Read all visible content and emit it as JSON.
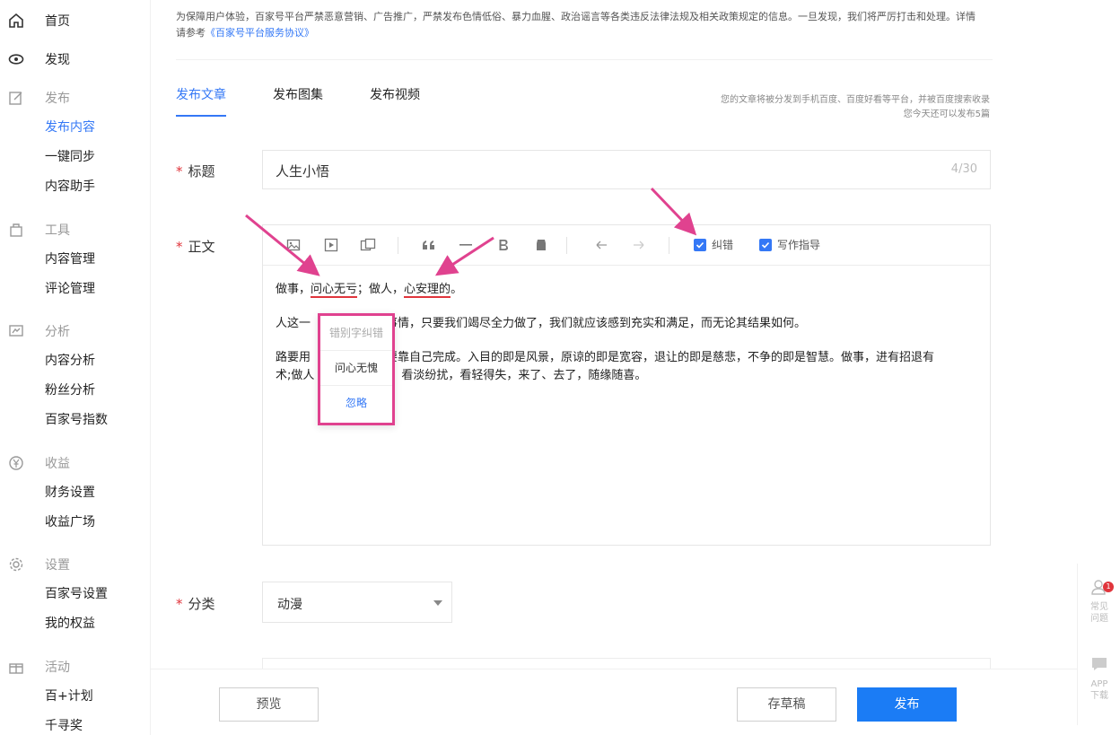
{
  "sidebar": {
    "groups": [
      {
        "icon": "home-icon",
        "label": "首页",
        "items": []
      },
      {
        "icon": "eye-icon",
        "label": "发现",
        "items": []
      },
      {
        "icon": "edit-icon",
        "label": "发布",
        "items": [
          "发布内容",
          "一键同步",
          "内容助手"
        ],
        "active_item": "发布内容"
      },
      {
        "icon": "briefcase-icon",
        "label": "工具",
        "items": [
          "内容管理",
          "评论管理"
        ]
      },
      {
        "icon": "chart-icon",
        "label": "分析",
        "items": [
          "内容分析",
          "粉丝分析",
          "百家号指数"
        ]
      },
      {
        "icon": "yuan-icon",
        "label": "收益",
        "items": [
          "财务设置",
          "收益广场"
        ]
      },
      {
        "icon": "gear-icon",
        "label": "设置",
        "items": [
          "百家号设置",
          "我的权益"
        ]
      },
      {
        "icon": "gift-icon",
        "label": "活动",
        "items": [
          "百+计划",
          "千寻奖"
        ]
      }
    ]
  },
  "notice": {
    "text": "为保障用户体验，百家号平台严禁恶意营销、广告推广，严禁发布色情低俗、暴力血腥、政治谣言等各类违反法律法规及相关政策规定的信息。一旦发现，我们将严厉打击和处理。详情请参考",
    "link": "《百家号平台服务协议》"
  },
  "tabs": [
    {
      "label": "发布文章",
      "active": true
    },
    {
      "label": "发布图集",
      "active": false
    },
    {
      "label": "发布视频",
      "active": false
    }
  ],
  "info": {
    "line1": "您的文章将被分发到手机百度、百度好看等平台，并被百度搜索收录",
    "line2": "您今天还可以发布5篇"
  },
  "form": {
    "title_label": "标题",
    "title_value": "人生小悟",
    "title_count": "4/30",
    "body_label": "正文",
    "category_label": "分类",
    "category_value": "动漫",
    "required_mark": "*"
  },
  "toolbar": {
    "icons": [
      "image-icon",
      "video-icon",
      "gallery-icon",
      "quote-icon",
      "divider-icon",
      "bold-icon",
      "clear-format-icon",
      "undo-icon",
      "redo-icon"
    ],
    "check_spell": "纠错",
    "check_guide": "写作指导"
  },
  "content": {
    "p1": {
      "a": "做事，",
      "err1": "问心无亏",
      "b": "；做人，",
      "err2": "心安理的",
      "c": "。"
    },
    "p2": {
      "a": "人这一",
      "b": "事情，只要我们竭尽全力做了，我们就应该感到充实和满足，而无论其结果如何。"
    },
    "p3": {
      "a": "路要用",
      "b": "要靠自己完成。入目的即是风景，原谅的即是宽容，退让的即是慈悲，不争的即是智慧。做事，进有招退有",
      "c": "术;做人",
      "d": "，看淡纷扰，看轻得失，来了、去了，随缘随喜。"
    }
  },
  "popup": {
    "header": "错别字纠错",
    "suggestion": "问心无愧",
    "ignore": "忽略"
  },
  "footer": {
    "preview": "预览",
    "draft": "存草稿",
    "publish": "发布"
  },
  "float": {
    "faq": "常见问题",
    "app": "APP下载",
    "badge": "1"
  },
  "colors": {
    "accent": "#3478f6",
    "error": "#e0353c",
    "highlight": "#e0428f",
    "primary_button": "#1b7cf5"
  }
}
